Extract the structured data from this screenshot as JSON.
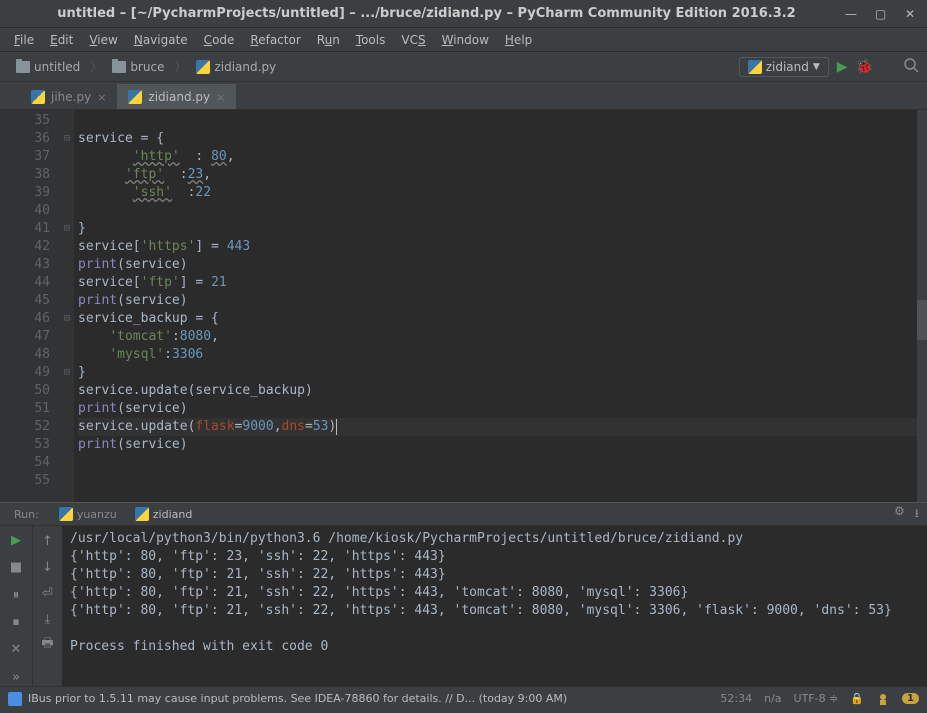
{
  "window": {
    "title": "untitled – [~/PycharmProjects/untitled] – .../bruce/zidiand.py – PyCharm Community Edition 2016.3.2"
  },
  "menu": {
    "file": "File",
    "edit": "Edit",
    "view": "View",
    "navigate": "Navigate",
    "code": "Code",
    "refactor": "Refactor",
    "run": "Run",
    "tools": "Tools",
    "vcs": "VCS",
    "window": "Window",
    "help": "Help"
  },
  "breadcrumb": {
    "project": "untitled",
    "folder": "bruce",
    "file": "zidiand.py"
  },
  "toolbar": {
    "run_config": "zidiand"
  },
  "tabs": {
    "tab1": "jihe.py",
    "tab2": "zidiand.py"
  },
  "code": {
    "lines": [
      {
        "n": "35",
        "html": ""
      },
      {
        "n": "36",
        "fold": "⊟",
        "html": "service = {"
      },
      {
        "n": "37",
        "html": "       <span class='str wave'>'http'</span>  : <span class='num wave'>80</span>,"
      },
      {
        "n": "38",
        "html": "      <span class='str wave'>'ftp'</span>  :<span class='num wave'>23</span>,"
      },
      {
        "n": "39",
        "html": "       <span class='str wave'>'ssh'</span>  :<span class='num'>22</span>"
      },
      {
        "n": "40",
        "html": ""
      },
      {
        "n": "41",
        "fold": "⊟",
        "html": "}"
      },
      {
        "n": "42",
        "html": "service[<span class='str'>'https'</span>] = <span class='num'>443</span>"
      },
      {
        "n": "43",
        "html": "<span class='builtin'>print</span>(service)"
      },
      {
        "n": "44",
        "html": "service[<span class='str'>'ftp'</span>] = <span class='num'>21</span>"
      },
      {
        "n": "45",
        "html": "<span class='builtin'>print</span>(service)"
      },
      {
        "n": "46",
        "fold": "⊟",
        "html": "service_backup = {"
      },
      {
        "n": "47",
        "html": "    <span class='str'>'tomcat'</span>:<span class='num'>8080</span>,"
      },
      {
        "n": "48",
        "html": "    <span class='str'>'mysql'</span>:<span class='num'>3306</span>"
      },
      {
        "n": "49",
        "fold": "⊟",
        "html": "}"
      },
      {
        "n": "50",
        "html": "service.update(service_backup)"
      },
      {
        "n": "51",
        "html": "<span class='builtin'>print</span>(service)"
      },
      {
        "n": "52",
        "current": true,
        "html": "service.update(<span class='param'>flask</span>=<span class='num'>9000</span>,<span class='param'>dns</span>=<span class='num'>53</span>)<span class='caret'></span>"
      },
      {
        "n": "53",
        "html": "<span class='builtin'>print</span>(service)"
      },
      {
        "n": "54",
        "html": ""
      },
      {
        "n": "55",
        "html": ""
      }
    ]
  },
  "run": {
    "label": "Run:",
    "tab1": "yuanzu",
    "tab2": "zidiand",
    "output": "/usr/local/python3/bin/python3.6 /home/kiosk/PycharmProjects/untitled/bruce/zidiand.py\n{'http': 80, 'ftp': 23, 'ssh': 22, 'https': 443}\n{'http': 80, 'ftp': 21, 'ssh': 22, 'https': 443}\n{'http': 80, 'ftp': 21, 'ssh': 22, 'https': 443, 'tomcat': 8080, 'mysql': 3306}\n{'http': 80, 'ftp': 21, 'ssh': 22, 'https': 443, 'tomcat': 8080, 'mysql': 3306, 'flask': 9000, 'dns': 53}\n\nProcess finished with exit code 0"
  },
  "status": {
    "message": "IBus prior to 1.5.11 may cause input problems. See IDEA-78860 for details. // D... (today 9:00 AM)",
    "pos": "52:34",
    "na": "n/a",
    "encoding": "UTF-8",
    "lock": "�But",
    "warnings": "1"
  }
}
